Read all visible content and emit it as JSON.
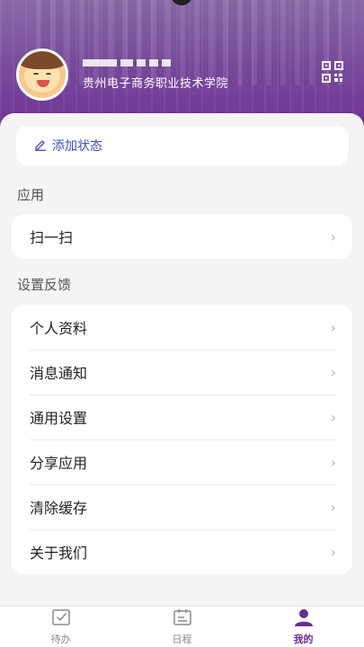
{
  "header": {
    "school_name": "贵州电子商务职业技术学院",
    "username_masked": "██ ██ ██ █"
  },
  "status": {
    "add_label": "添加状态"
  },
  "sections": {
    "apps_title": "应用",
    "settings_title": "设置反馈"
  },
  "apps": [
    {
      "label": "扫一扫"
    }
  ],
  "settings": [
    {
      "label": "个人资料"
    },
    {
      "label": "消息通知"
    },
    {
      "label": "通用设置"
    },
    {
      "label": "分享应用"
    },
    {
      "label": "清除缓存"
    },
    {
      "label": "关于我们"
    }
  ],
  "tabs": [
    {
      "label": "待办",
      "icon": "todo-check-icon",
      "active": false
    },
    {
      "label": "日程",
      "icon": "calendar-icon",
      "active": false
    },
    {
      "label": "我的",
      "icon": "person-icon",
      "active": true
    }
  ],
  "colors": {
    "accent": "#6b2c91",
    "link": "#3a4fd0"
  }
}
